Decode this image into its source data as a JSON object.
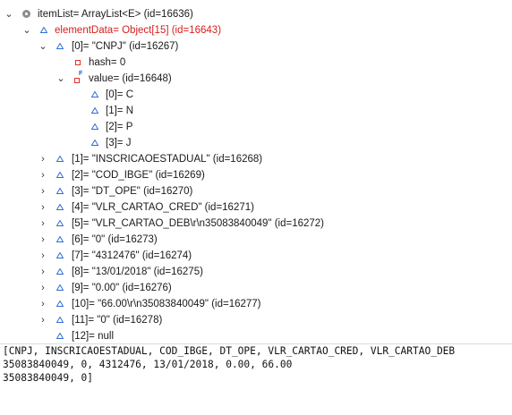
{
  "tree": {
    "root_label": "itemList= ArrayList<E>  (id=16636)",
    "element_data_label": "elementData= Object[15]  (id=16643)",
    "item0": {
      "label": "[0]= \"CNPJ\" (id=16267)",
      "hash_label": "hash= 0",
      "value_label": "value= (id=16648)",
      "chars": [
        "[0]= C",
        "[1]= N",
        "[2]= P",
        "[3]= J"
      ]
    },
    "items": [
      "[1]= \"INSCRICAOESTADUAL\" (id=16268)",
      "[2]= \"COD_IBGE\" (id=16269)",
      "[3]= \"DT_OPE\" (id=16270)",
      "[4]= \"VLR_CARTAO_CRED\" (id=16271)",
      "[5]= \"VLR_CARTAO_DEB\\r\\n35083840049\" (id=16272)",
      "[6]= \"0\" (id=16273)",
      "[7]= \"4312476\" (id=16274)",
      "[8]= \"13/01/2018\" (id=16275)",
      "[9]= \"0.00\" (id=16276)",
      "[10]= \"66.00\\r\\n35083840049\" (id=16277)",
      "[11]= \"0\" (id=16278)",
      "[12]= null"
    ]
  },
  "console": {
    "lines": [
      "[CNPJ, INSCRICAOESTADUAL, COD_IBGE, DT_OPE, VLR_CARTAO_CRED, VLR_CARTAO_DEB",
      "35083840049, 0, 4312476, 13/01/2018, 0.00, 66.00",
      "35083840049, 0]"
    ]
  },
  "colors": {
    "triangle_outline": "#2f6fd6",
    "field_highlight": "#d6201d",
    "private_field": "#e03030"
  },
  "icons": {
    "expanded": "chevron-down-icon",
    "collapsed": "chevron-right-icon",
    "root": "local-variable-icon",
    "element": "blue-triangle-icon",
    "private_field": "private-field-icon",
    "final_field": "final-field-icon"
  }
}
